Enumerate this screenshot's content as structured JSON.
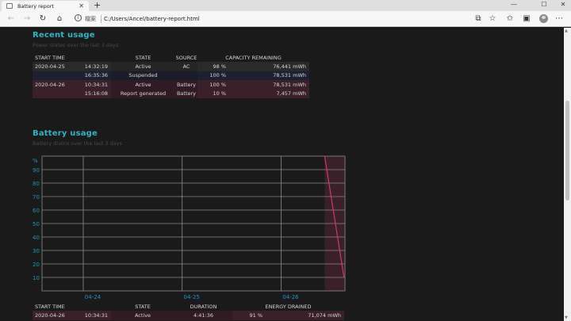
{
  "browser": {
    "tab_title": "Battery report",
    "tab_close": "✕",
    "new_tab": "+",
    "address_label": "檔案",
    "address_info": "i",
    "address_url": "C:/Users/Ancel/battery-report.html",
    "icons": [
      "back-arrow-icon",
      "forward-arrow-icon",
      "refresh-icon",
      "home-icon",
      "tab-actions-icon",
      "favorite-star-icon",
      "favorites-icon",
      "collections-icon",
      "profile-icon",
      "more-icon"
    ]
  },
  "recent_usage": {
    "title": "Recent usage",
    "subtitle": "Power states over the last 3 days",
    "headers": [
      "START TIME",
      "STATE",
      "SOURCE",
      "CAPACITY REMAINING"
    ],
    "rows": [
      {
        "date": "2020-04-25",
        "time": "14:32:19",
        "state": "Active",
        "source": "AC",
        "pct": "98 %",
        "mwh": "76,441 mWh",
        "highlight": false
      },
      {
        "date": "",
        "time": "16:35:36",
        "state": "Suspended",
        "source": "",
        "pct": "100 %",
        "mwh": "78,531 mWh",
        "highlight": false
      },
      {
        "date": "2020-04-26",
        "time": "10:34:31",
        "state": "Active",
        "source": "Battery",
        "pct": "100 %",
        "mwh": "78,531 mWh",
        "highlight": true
      },
      {
        "date": "",
        "time": "15:16:08",
        "state": "Report generated",
        "source": "Battery",
        "pct": "10 %",
        "mwh": "7,457 mWh",
        "highlight": true
      }
    ]
  },
  "battery_usage": {
    "title": "Battery usage",
    "subtitle": "Battery drains over the last 3 days",
    "headers": [
      "START TIME",
      "STATE",
      "DURATION",
      "ENERGY DRAINED"
    ],
    "rows": [
      {
        "date": "2020-04-26",
        "time": "10:34:31",
        "state": "Active",
        "duration": "4:41:36",
        "pct": "91 %",
        "mwh": "71,074 mWh"
      }
    ]
  },
  "chart_data": {
    "type": "line",
    "title": "",
    "xlabel": "",
    "ylabel": "%",
    "ylim": [
      0,
      100
    ],
    "yticks": [
      10,
      20,
      30,
      40,
      50,
      60,
      70,
      80,
      90
    ],
    "xticks": [
      "04-24",
      "04-25",
      "04-26"
    ],
    "series": [
      {
        "color": "#d03a5c",
        "x": [
          "2020-04-26 10:34",
          "2020-04-26 15:16"
        ],
        "y": [
          100,
          10
        ]
      }
    ],
    "grid": true,
    "colors": {
      "axis_label": "#1e95c6",
      "grid": "#8c8c8c",
      "line": "#d03a5c",
      "drain_band": "#3a2028"
    }
  }
}
